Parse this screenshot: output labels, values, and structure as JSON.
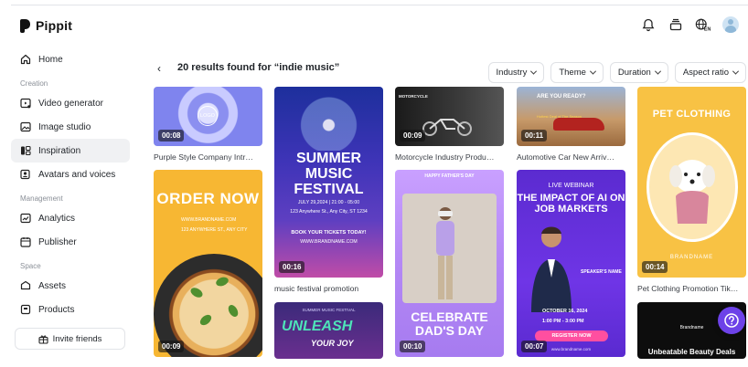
{
  "app": {
    "name": "Pippit"
  },
  "sidebar": {
    "items_top": [
      {
        "label": "Home",
        "icon": "home-icon"
      }
    ],
    "sections": [
      {
        "label": "Creation",
        "items": [
          {
            "label": "Video generator",
            "icon": "video-generator-icon"
          },
          {
            "label": "Image studio",
            "icon": "image-studio-icon"
          },
          {
            "label": "Inspiration",
            "icon": "inspiration-icon",
            "active": true
          },
          {
            "label": "Avatars and voices",
            "icon": "avatar-icon"
          }
        ]
      },
      {
        "label": "Management",
        "items": [
          {
            "label": "Analytics",
            "icon": "analytics-icon"
          },
          {
            "label": "Publisher",
            "icon": "calendar-icon"
          }
        ]
      },
      {
        "label": "Space",
        "items": [
          {
            "label": "Assets",
            "icon": "assets-icon"
          },
          {
            "label": "Products",
            "icon": "products-icon"
          }
        ]
      }
    ],
    "invite_label": "Invite friends"
  },
  "results": {
    "back_label": "‹",
    "title": "20 results found for “indie music”"
  },
  "filters": [
    "Industry",
    "Theme",
    "Duration",
    "Aspect ratio"
  ],
  "cards": {
    "c1": {
      "duration": "00:08",
      "caption": "Purple Style Company Intr…",
      "logo": "LOGO"
    },
    "c2": {
      "duration": "00:09",
      "title": "ORDER NOW",
      "line1": "WWW.BRANDNAME.COM",
      "line2": "123 ANYWHERE ST., ANY CITY"
    },
    "c3": {
      "duration": "00:16",
      "caption": "music festival promotion",
      "title": "SUMMER MUSIC FESTIVAL",
      "date": "JULY 29,2024 | 21:00 - 05:00",
      "address": "123 Anywhere St., Any City, ST 1234",
      "tickets": "BOOK YOUR TICKETS TODAY!",
      "url": "WWW.BRANDNAME.COM"
    },
    "c4": {
      "header": "SUMMER MUSIC FESTIVAL",
      "title": "UNLEASH",
      "subtitle": "YOUR JOY"
    },
    "c5": {
      "duration": "00:09",
      "caption": "Motorcycle Industry Produ…",
      "header": "MOTORCYCLE"
    },
    "c6": {
      "duration": "00:10",
      "header": "HAPPY FATHER'S DAY",
      "title": "CELEBRATE DAD'S DAY"
    },
    "c7": {
      "duration": "00:11",
      "caption": "Automotive Car New Arriv…",
      "title": "ARE YOU READY?",
      "subtitle": "Hottest Deal of The Season"
    },
    "c8": {
      "duration": "00:07",
      "header": "LIVE WEBINAR",
      "title": "THE IMPACT OF AI ON JOB MARKETS",
      "speaker": "SPEAKER'S NAME",
      "date": "OCTOBER 16, 2024",
      "time": "1:00 PM - 3:00 PM",
      "register": "REGISTER NOW",
      "url": "www.brandname.com"
    },
    "c9": {
      "duration": "00:14",
      "caption": "Pet Clothing Promotion Tik…",
      "title": "PET CLOTHING",
      "brand": "BRANDNAME"
    },
    "c10": {
      "brand": "Brandname",
      "title": "Unbeatable Beauty Deals"
    }
  }
}
